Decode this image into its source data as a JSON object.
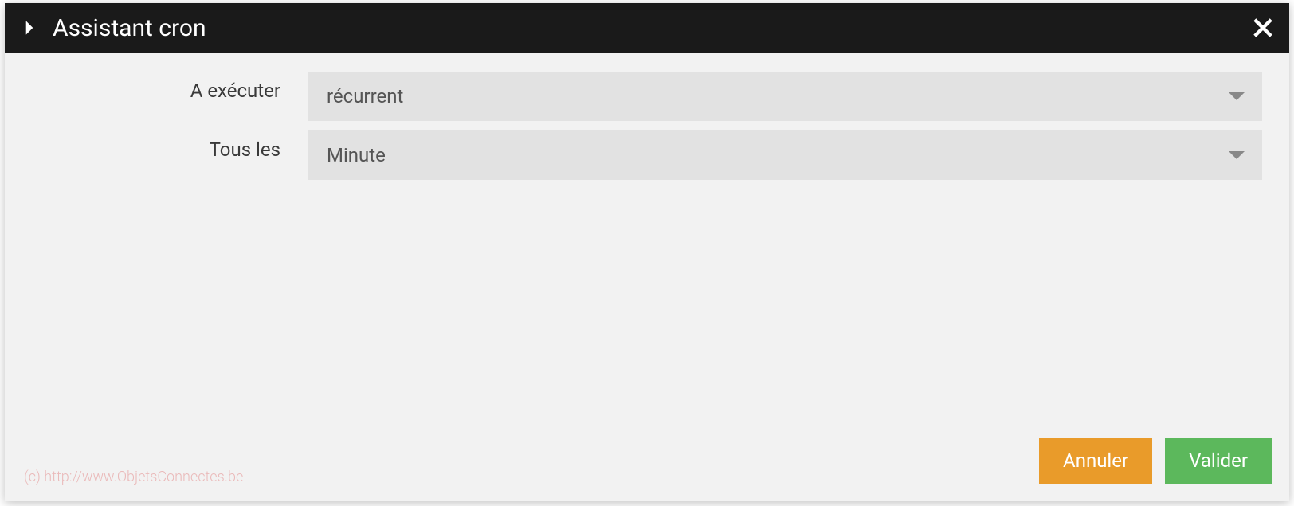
{
  "modal": {
    "title": "Assistant cron"
  },
  "form": {
    "execute_label": "A exécuter",
    "execute_value": "récurrent",
    "every_label": "Tous les",
    "every_value": "Minute"
  },
  "footer": {
    "cancel_label": "Annuler",
    "validate_label": "Valider"
  },
  "watermark": "(c) http://www.ObjetsConnectes.be"
}
